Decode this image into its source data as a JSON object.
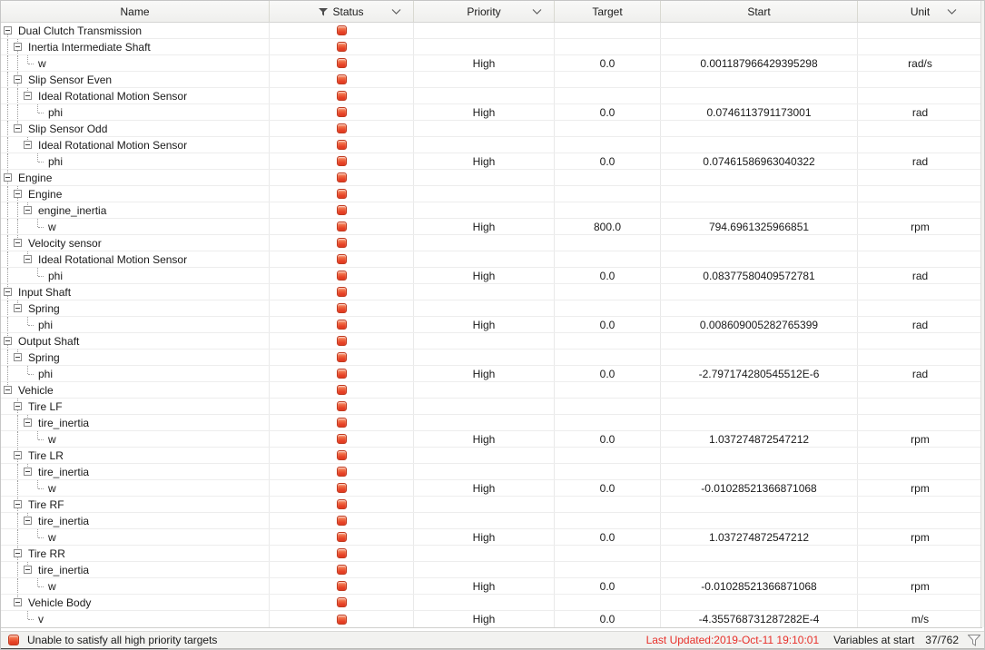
{
  "columns": [
    {
      "id": "name",
      "label": "Name",
      "icons": []
    },
    {
      "id": "status",
      "label": "Status",
      "icons": [
        "funnel-icon",
        "chevron-down-icon"
      ]
    },
    {
      "id": "priority",
      "label": "Priority",
      "icons": [
        "chevron-down-icon"
      ]
    },
    {
      "id": "target",
      "label": "Target",
      "icons": []
    },
    {
      "id": "start",
      "label": "Start",
      "icons": []
    },
    {
      "id": "unit",
      "label": "Unit",
      "icons": [
        "chevron-down-icon"
      ]
    }
  ],
  "rows": [
    {
      "name": "Dual Clutch Transmission",
      "level": 0,
      "kind": "branch",
      "status": "error"
    },
    {
      "name": "Inertia Intermediate Shaft",
      "level": 1,
      "kind": "branch",
      "status": "error"
    },
    {
      "name": "w",
      "level": 2,
      "kind": "leaf",
      "status": "error",
      "priority": "High",
      "target": "0.0",
      "start": "0.001187966429395298",
      "unit": "rad/s"
    },
    {
      "name": "Slip Sensor Even",
      "level": 1,
      "kind": "branch",
      "status": "error"
    },
    {
      "name": "Ideal Rotational Motion Sensor",
      "level": 2,
      "kind": "branch",
      "status": "error"
    },
    {
      "name": "phi",
      "level": 3,
      "kind": "leaf",
      "status": "error",
      "priority": "High",
      "target": "0.0",
      "start": "0.0746113791173001",
      "unit": "rad"
    },
    {
      "name": "Slip Sensor Odd",
      "level": 1,
      "kind": "branch",
      "status": "error"
    },
    {
      "name": "Ideal Rotational Motion Sensor",
      "level": 2,
      "kind": "branch",
      "status": "error"
    },
    {
      "name": "phi",
      "level": 3,
      "kind": "leaf",
      "status": "error",
      "priority": "High",
      "target": "0.0",
      "start": "0.07461586963040322",
      "unit": "rad"
    },
    {
      "name": "Engine",
      "level": 0,
      "kind": "branch",
      "status": "error"
    },
    {
      "name": "Engine",
      "level": 1,
      "kind": "branch",
      "status": "error"
    },
    {
      "name": "engine_inertia",
      "level": 2,
      "kind": "branch",
      "status": "error"
    },
    {
      "name": "w",
      "level": 3,
      "kind": "leaf",
      "status": "error",
      "priority": "High",
      "target": "800.0",
      "start": "794.6961325966851",
      "unit": "rpm"
    },
    {
      "name": "Velocity sensor",
      "level": 1,
      "kind": "branch",
      "status": "error"
    },
    {
      "name": "Ideal Rotational Motion Sensor",
      "level": 2,
      "kind": "branch",
      "status": "error"
    },
    {
      "name": "phi",
      "level": 3,
      "kind": "leaf",
      "status": "error",
      "priority": "High",
      "target": "0.0",
      "start": "0.08377580409572781",
      "unit": "rad"
    },
    {
      "name": "Input Shaft",
      "level": 0,
      "kind": "branch",
      "status": "error"
    },
    {
      "name": "Spring",
      "level": 1,
      "kind": "branch",
      "status": "error"
    },
    {
      "name": "phi",
      "level": 2,
      "kind": "leaf",
      "status": "error",
      "priority": "High",
      "target": "0.0",
      "start": "0.008609005282765399",
      "unit": "rad"
    },
    {
      "name": "Output Shaft",
      "level": 0,
      "kind": "branch",
      "status": "error"
    },
    {
      "name": "Spring",
      "level": 1,
      "kind": "branch",
      "status": "error"
    },
    {
      "name": "phi",
      "level": 2,
      "kind": "leaf",
      "status": "error",
      "priority": "High",
      "target": "0.0",
      "start": "-2.797174280545512E-6",
      "unit": "rad"
    },
    {
      "name": "Vehicle",
      "level": 0,
      "kind": "branch",
      "status": "error"
    },
    {
      "name": "Tire LF",
      "level": 1,
      "kind": "branch",
      "status": "error"
    },
    {
      "name": "tire_inertia",
      "level": 2,
      "kind": "branch",
      "status": "error"
    },
    {
      "name": "w",
      "level": 3,
      "kind": "leaf",
      "status": "error",
      "priority": "High",
      "target": "0.0",
      "start": "1.037274872547212",
      "unit": "rpm"
    },
    {
      "name": "Tire LR",
      "level": 1,
      "kind": "branch",
      "status": "error"
    },
    {
      "name": "tire_inertia",
      "level": 2,
      "kind": "branch",
      "status": "error"
    },
    {
      "name": "w",
      "level": 3,
      "kind": "leaf",
      "status": "error",
      "priority": "High",
      "target": "0.0",
      "start": "-0.01028521366871068",
      "unit": "rpm"
    },
    {
      "name": "Tire RF",
      "level": 1,
      "kind": "branch",
      "status": "error"
    },
    {
      "name": "tire_inertia",
      "level": 2,
      "kind": "branch",
      "status": "error"
    },
    {
      "name": "w",
      "level": 3,
      "kind": "leaf",
      "status": "error",
      "priority": "High",
      "target": "0.0",
      "start": "1.037274872547212",
      "unit": "rpm"
    },
    {
      "name": "Tire RR",
      "level": 1,
      "kind": "branch",
      "status": "error"
    },
    {
      "name": "tire_inertia",
      "level": 2,
      "kind": "branch",
      "status": "error"
    },
    {
      "name": "w",
      "level": 3,
      "kind": "leaf",
      "status": "error",
      "priority": "High",
      "target": "0.0",
      "start": "-0.01028521366871068",
      "unit": "rpm"
    },
    {
      "name": "Vehicle Body",
      "level": 1,
      "kind": "branch",
      "status": "error"
    },
    {
      "name": "v",
      "level": 2,
      "kind": "leaf",
      "status": "error",
      "priority": "High",
      "target": "0.0",
      "start": "-4.355768731287282E-4",
      "unit": "m/s"
    }
  ],
  "status_bar": {
    "status_icon": "error-icon",
    "message": "Unable to satisfy all high priority targets",
    "last_updated": "Last Updated:2019-Oct-11 19:10:01",
    "variables_label": "Variables at start",
    "variables_count": "37/762",
    "filter_icon": "funnel-icon"
  },
  "colors": {
    "status_icon_red": "#e74327",
    "status_icon_border": "#bf3a20",
    "last_updated_red": "#e8302a"
  }
}
